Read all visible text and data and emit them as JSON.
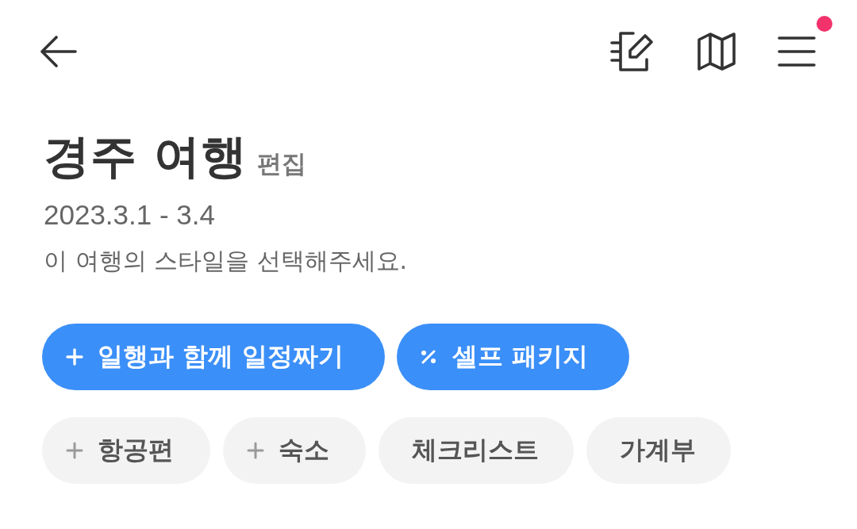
{
  "top_bar": {
    "menu_notification": true
  },
  "trip": {
    "title": "경주 여행",
    "edit_link": "편집",
    "dates": "2023.3.1 - 3.4",
    "prompt": "이 여행의 스타일을 선택해주세요."
  },
  "style_buttons": [
    {
      "label": "일행과 함께 일정짜기",
      "kind": "add"
    },
    {
      "label": "셀프 패키지",
      "kind": "discount"
    }
  ],
  "extra_buttons": [
    {
      "label": "항공편",
      "kind": "add"
    },
    {
      "label": "숙소",
      "kind": "add"
    },
    {
      "label": "체크리스트",
      "kind": "plain"
    },
    {
      "label": "가계부",
      "kind": "plain"
    }
  ]
}
